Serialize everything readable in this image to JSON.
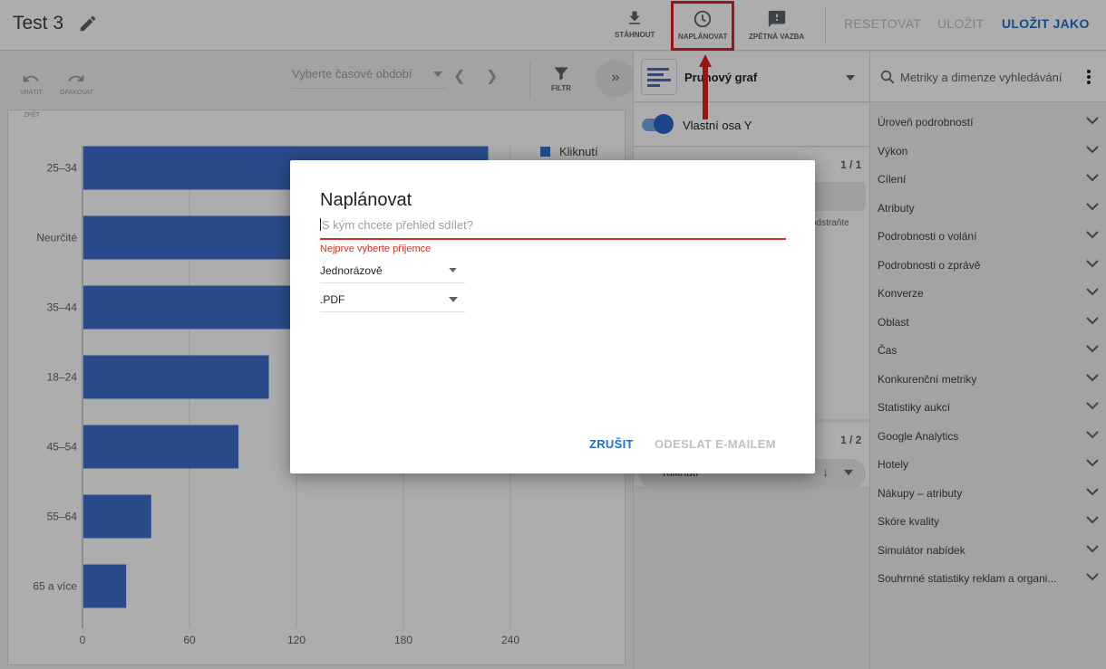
{
  "header": {
    "title": "Test 3",
    "download_label": "STÁHNOUT",
    "schedule_label": "NAPLÁNOVAT",
    "feedback_label": "ZPĚTNÁ VAZBA",
    "reset_label": "RESETOVAT",
    "save_label": "ULOŽIT",
    "save_as_label": "ULOŽIT JAKO",
    "accent_color": "#1f6fc5",
    "highlight_color": "#e02020"
  },
  "toolbar": {
    "undo_label": "VRÁTIT",
    "redo_label": "OPAKOVAT",
    "back_label": "ZPĚT",
    "period_placeholder": "Vyberte časové období",
    "filter_label": "FILTR"
  },
  "chart_data": {
    "type": "bar",
    "orientation": "horizontal",
    "categories": [
      "25–34",
      "Neurčité",
      "35–44",
      "18–24",
      "45–54",
      "55–64",
      "65 a více"
    ],
    "series": [
      {
        "name": "Kliknutí",
        "values": [
          227,
          200,
          170,
          104,
          87,
          38,
          24
        ],
        "color": "#3d6fcf"
      }
    ],
    "x_ticks": [
      "0",
      "60",
      "120",
      "180",
      "240"
    ],
    "xlim": [
      0,
      300
    ],
    "legend_position": "top-right",
    "grid": true
  },
  "properties": {
    "chart_type_label": "Pruhový graf",
    "axis_toggle_label": "Vlastní osa Y",
    "axis_toggle_on": true,
    "page_top": "1 / 1",
    "hint_fragment": "odstraňte",
    "page_bottom": "1 / 2",
    "metric_chip_label": "Kliknutí"
  },
  "data_panel": {
    "search_placeholder": "Metriky a dimenze vyhledávání",
    "categories": [
      "Úroveň podrobností",
      "Výkon",
      "Cílení",
      "Atributy",
      "Podrobnosti o volání",
      "Podrobnosti o zprávě",
      "Konverze",
      "Oblast",
      "Čas",
      "Konkurenční metriky",
      "Statistiky aukcí",
      "Google Analytics",
      "Hotely",
      "Nákupy – atributy",
      "Skóre kvality",
      "Simulátor nabídek",
      "Souhrnné statistiky reklam a organi..."
    ]
  },
  "dialog": {
    "title": "Naplánovat",
    "recipient_placeholder": "S kým chcete přehled sdílet?",
    "error_text": "Nejprve vyberte příjemce",
    "frequency_value": "Jednorázově",
    "format_value": ".PDF",
    "cancel_label": "ZRUŠIT",
    "send_label": "ODESLAT E-MAILEM"
  }
}
